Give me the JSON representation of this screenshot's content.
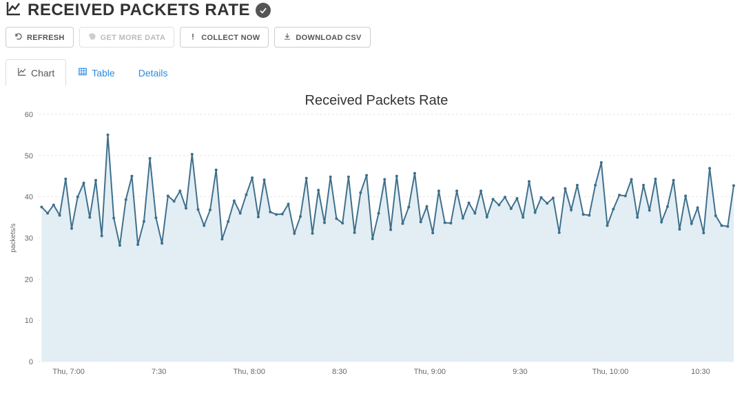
{
  "header": {
    "title": "RECEIVED PACKETS RATE"
  },
  "toolbar": {
    "refresh": "Refresh",
    "get_more_data": "Get More Data",
    "collect_now": "Collect Now",
    "download_csv": "Download CSV"
  },
  "tabs": {
    "chart": "Chart",
    "table": "Table",
    "details": "Details"
  },
  "chart_data": {
    "type": "area",
    "title": "Received Packets Rate",
    "xlabel": "",
    "ylabel": "packets/s",
    "ylim": [
      0,
      60
    ],
    "y_ticks": [
      0,
      10,
      20,
      30,
      40,
      50,
      60
    ],
    "xlim_minutes": [
      410,
      641
    ],
    "x_ticks": [
      {
        "minute": 420,
        "label": "Thu, 7:00"
      },
      {
        "minute": 450,
        "label": "7:30"
      },
      {
        "minute": 480,
        "label": "Thu, 8:00"
      },
      {
        "minute": 510,
        "label": "8:30"
      },
      {
        "minute": 540,
        "label": "Thu, 9:00"
      },
      {
        "minute": 570,
        "label": "9:30"
      },
      {
        "minute": 600,
        "label": "Thu, 10:00"
      },
      {
        "minute": 630,
        "label": "10:30"
      }
    ],
    "series": [
      {
        "name": "Received Packets Rate",
        "color": "#3f6f8c",
        "points": [
          {
            "minute": 411,
            "value": 37.5
          },
          {
            "minute": 413,
            "value": 36.0
          },
          {
            "minute": 415,
            "value": 38.0
          },
          {
            "minute": 417,
            "value": 35.5
          },
          {
            "minute": 419,
            "value": 44.3
          },
          {
            "minute": 421,
            "value": 32.3
          },
          {
            "minute": 423,
            "value": 40.0
          },
          {
            "minute": 425,
            "value": 43.3
          },
          {
            "minute": 427,
            "value": 35.0
          },
          {
            "minute": 429,
            "value": 44.0
          },
          {
            "minute": 431,
            "value": 30.5
          },
          {
            "minute": 433,
            "value": 55.0
          },
          {
            "minute": 435,
            "value": 34.8
          },
          {
            "minute": 437,
            "value": 28.2
          },
          {
            "minute": 439,
            "value": 39.3
          },
          {
            "minute": 441,
            "value": 45.0
          },
          {
            "minute": 443,
            "value": 28.4
          },
          {
            "minute": 445,
            "value": 34.0
          },
          {
            "minute": 447,
            "value": 49.3
          },
          {
            "minute": 449,
            "value": 34.9
          },
          {
            "minute": 451,
            "value": 28.7
          },
          {
            "minute": 453,
            "value": 40.2
          },
          {
            "minute": 455,
            "value": 38.9
          },
          {
            "minute": 457,
            "value": 41.4
          },
          {
            "minute": 459,
            "value": 37.2
          },
          {
            "minute": 461,
            "value": 50.3
          },
          {
            "minute": 463,
            "value": 36.9
          },
          {
            "minute": 465,
            "value": 33.0
          },
          {
            "minute": 467,
            "value": 36.8
          },
          {
            "minute": 469,
            "value": 46.5
          },
          {
            "minute": 471,
            "value": 29.7
          },
          {
            "minute": 473,
            "value": 34.0
          },
          {
            "minute": 475,
            "value": 39.0
          },
          {
            "minute": 477,
            "value": 36.0
          },
          {
            "minute": 479,
            "value": 40.5
          },
          {
            "minute": 481,
            "value": 44.6
          },
          {
            "minute": 483,
            "value": 35.1
          },
          {
            "minute": 485,
            "value": 44.1
          },
          {
            "minute": 487,
            "value": 36.3
          },
          {
            "minute": 489,
            "value": 35.7
          },
          {
            "minute": 491,
            "value": 35.8
          },
          {
            "minute": 493,
            "value": 38.2
          },
          {
            "minute": 495,
            "value": 31.1
          },
          {
            "minute": 497,
            "value": 35.2
          },
          {
            "minute": 499,
            "value": 44.5
          },
          {
            "minute": 501,
            "value": 31.1
          },
          {
            "minute": 503,
            "value": 41.6
          },
          {
            "minute": 505,
            "value": 33.7
          },
          {
            "minute": 507,
            "value": 44.8
          },
          {
            "minute": 509,
            "value": 34.7
          },
          {
            "minute": 511,
            "value": 33.6
          },
          {
            "minute": 513,
            "value": 44.8
          },
          {
            "minute": 515,
            "value": 31.3
          },
          {
            "minute": 517,
            "value": 41.0
          },
          {
            "minute": 519,
            "value": 45.2
          },
          {
            "minute": 521,
            "value": 29.8
          },
          {
            "minute": 523,
            "value": 36.0
          },
          {
            "minute": 525,
            "value": 44.2
          },
          {
            "minute": 527,
            "value": 32.0
          },
          {
            "minute": 529,
            "value": 45.0
          },
          {
            "minute": 531,
            "value": 33.5
          },
          {
            "minute": 533,
            "value": 37.5
          },
          {
            "minute": 535,
            "value": 45.7
          },
          {
            "minute": 537,
            "value": 33.9
          },
          {
            "minute": 539,
            "value": 37.6
          },
          {
            "minute": 541,
            "value": 31.2
          },
          {
            "minute": 543,
            "value": 41.4
          },
          {
            "minute": 545,
            "value": 33.7
          },
          {
            "minute": 547,
            "value": 33.6
          },
          {
            "minute": 549,
            "value": 41.4
          },
          {
            "minute": 551,
            "value": 34.8
          },
          {
            "minute": 553,
            "value": 38.5
          },
          {
            "minute": 555,
            "value": 36.0
          },
          {
            "minute": 557,
            "value": 41.4
          },
          {
            "minute": 559,
            "value": 35.1
          },
          {
            "minute": 561,
            "value": 39.4
          },
          {
            "minute": 563,
            "value": 38.0
          },
          {
            "minute": 565,
            "value": 39.9
          },
          {
            "minute": 567,
            "value": 37.1
          },
          {
            "minute": 569,
            "value": 39.6
          },
          {
            "minute": 571,
            "value": 35.0
          },
          {
            "minute": 573,
            "value": 43.7
          },
          {
            "minute": 575,
            "value": 36.2
          },
          {
            "minute": 577,
            "value": 39.8
          },
          {
            "minute": 579,
            "value": 38.4
          },
          {
            "minute": 581,
            "value": 39.7
          },
          {
            "minute": 583,
            "value": 31.3
          },
          {
            "minute": 585,
            "value": 42.0
          },
          {
            "minute": 587,
            "value": 36.8
          },
          {
            "minute": 589,
            "value": 42.8
          },
          {
            "minute": 591,
            "value": 35.7
          },
          {
            "minute": 593,
            "value": 35.5
          },
          {
            "minute": 595,
            "value": 42.8
          },
          {
            "minute": 597,
            "value": 48.3
          },
          {
            "minute": 599,
            "value": 33.0
          },
          {
            "minute": 601,
            "value": 37.0
          },
          {
            "minute": 603,
            "value": 40.4
          },
          {
            "minute": 605,
            "value": 40.2
          },
          {
            "minute": 607,
            "value": 44.2
          },
          {
            "minute": 609,
            "value": 35.0
          },
          {
            "minute": 611,
            "value": 42.8
          },
          {
            "minute": 613,
            "value": 36.7
          },
          {
            "minute": 615,
            "value": 44.3
          },
          {
            "minute": 617,
            "value": 33.9
          },
          {
            "minute": 619,
            "value": 37.6
          },
          {
            "minute": 621,
            "value": 44.0
          },
          {
            "minute": 623,
            "value": 32.1
          },
          {
            "minute": 625,
            "value": 40.2
          },
          {
            "minute": 627,
            "value": 33.5
          },
          {
            "minute": 629,
            "value": 37.3
          },
          {
            "minute": 631,
            "value": 31.2
          },
          {
            "minute": 633,
            "value": 46.9
          },
          {
            "minute": 635,
            "value": 35.4
          },
          {
            "minute": 637,
            "value": 33.0
          },
          {
            "minute": 639,
            "value": 32.8
          },
          {
            "minute": 641,
            "value": 42.7
          }
        ]
      }
    ]
  }
}
